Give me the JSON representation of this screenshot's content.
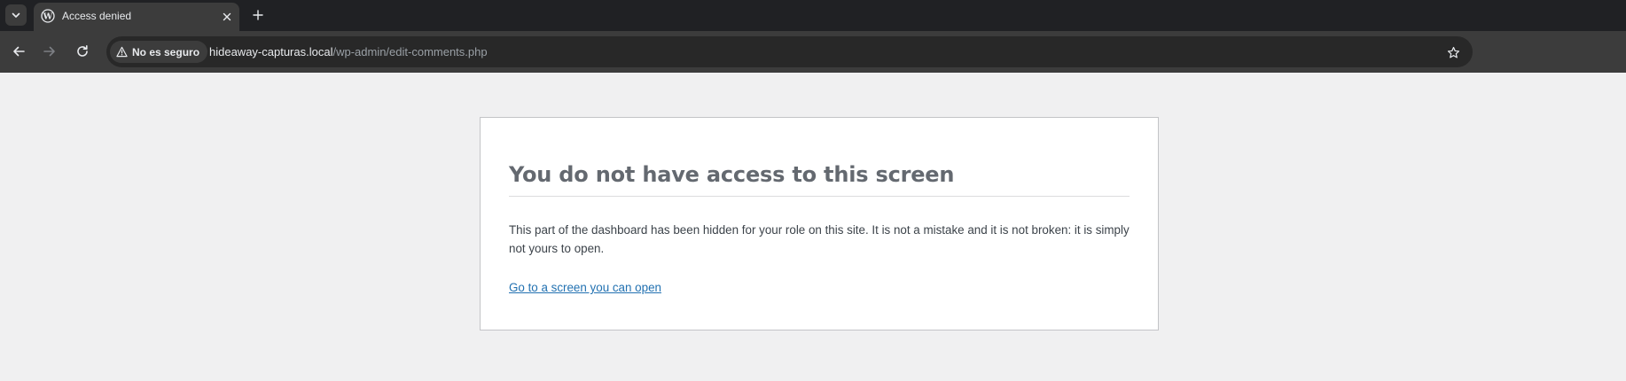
{
  "browser": {
    "tab": {
      "title": "Access denied",
      "favicon": "wordpress-icon"
    },
    "toolbar": {
      "back_icon": "arrow-left-icon",
      "forward_icon": "arrow-right-icon",
      "reload_icon": "reload-icon",
      "bookmark_icon": "star-icon"
    },
    "omnibox": {
      "security_label": "No es seguro",
      "security_icon": "warning-icon",
      "url_host": "hideaway-capturas.local",
      "url_path": "/wp-admin/edit-comments.php"
    }
  },
  "page": {
    "title": "You do not have access to this screen",
    "message": "This part of the dashboard has been hidden for your role on this site. It is not a mistake and it is not broken: it is simply not yours to open.",
    "link_label": "Go to a screen you can open"
  },
  "colors": {
    "tabstrip_bg": "#202124",
    "toolbar_bg": "#3c3c3c",
    "page_bg": "#f0f0f1",
    "title_color": "#646970",
    "link_color": "#2271b1"
  }
}
